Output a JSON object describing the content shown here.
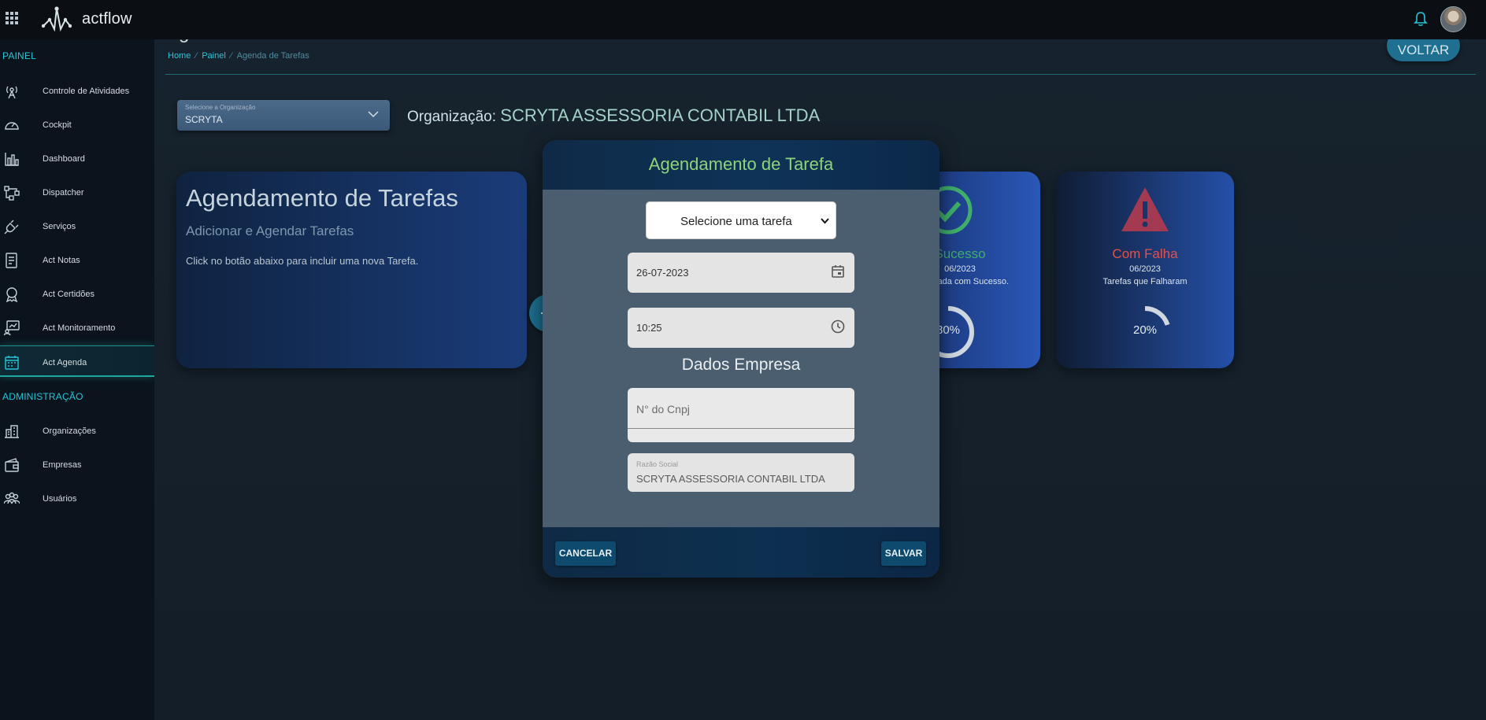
{
  "topbar": {
    "brand": "actflow",
    "icons": [
      "apps-grid-icon",
      "actflow-logo-icon",
      "bell-icon",
      "avatar"
    ]
  },
  "sidebar": {
    "sections": [
      {
        "title": "PAINEL",
        "items": [
          {
            "label": "Controle de Atividades",
            "icon": "antenna-icon"
          },
          {
            "label": "Cockpit",
            "icon": "gauge-icon"
          },
          {
            "label": "Dashboard",
            "icon": "bar-chart-icon"
          },
          {
            "label": "Dispatcher",
            "icon": "flow-icon"
          },
          {
            "label": "Serviços",
            "icon": "plug-icon"
          },
          {
            "label": "Act Notas",
            "icon": "notes-icon"
          },
          {
            "label": "Act Certidões",
            "icon": "ribbon-icon"
          },
          {
            "label": "Act Monitoramento",
            "icon": "monitor-icon"
          },
          {
            "label": "Act Agenda",
            "icon": "calendar-icon",
            "active": true
          }
        ]
      },
      {
        "title": "ADMINISTRAÇÃO",
        "items": [
          {
            "label": "Organizações",
            "icon": "building-icon"
          },
          {
            "label": "Empresas",
            "icon": "wallet-icon"
          },
          {
            "label": "Usuários",
            "icon": "users-icon"
          }
        ]
      }
    ]
  },
  "header": {
    "page_title": "Agenda de Tarefas",
    "breadcrumb": [
      "Home",
      "Painel",
      "Agenda de Tarefas"
    ],
    "back_label": "VOLTAR"
  },
  "org": {
    "select_label": "Selecione a Organização",
    "select_value": "SCRYTA",
    "prefix": "Organização:",
    "name": "SCRYTA ASSESSORIA CONTABIL LTDA"
  },
  "main_card": {
    "title": "Agendamento de Tarefas",
    "subtitle": "Adicionar e Agendar Tarefas",
    "description": "Click no botão abaixo para incluir uma nova Tarefa."
  },
  "stats": {
    "success": {
      "title": "Sucesso",
      "date": "06/2023",
      "desc": "Executada com Sucesso.",
      "percent": 80,
      "percent_label": "80%",
      "color": "#3fae6a"
    },
    "fail": {
      "title": "Com Falha",
      "date": "06/2023",
      "desc": "Tarefas que Falharam",
      "percent": 20,
      "percent_label": "20%",
      "color": "#e0524f"
    }
  },
  "modal": {
    "title": "Agendamento de Tarefa",
    "task_select": "Selecione uma tarefa",
    "date_value": "26-07-2023",
    "time_value": "10:25",
    "section_title": "Dados Empresa",
    "cnpj_placeholder": "N° do Cnpj",
    "razao_label": "Razão Social",
    "razao_value": "SCRYTA ASSESSORIA CONTABIL LTDA",
    "cancel_label": "CANCELAR",
    "save_label": "SALVAR"
  },
  "colors": {
    "accent": "#26c6da",
    "modal_title": "#8ed27a",
    "button": "#0e4a6d",
    "brand": "#e6eef2"
  }
}
